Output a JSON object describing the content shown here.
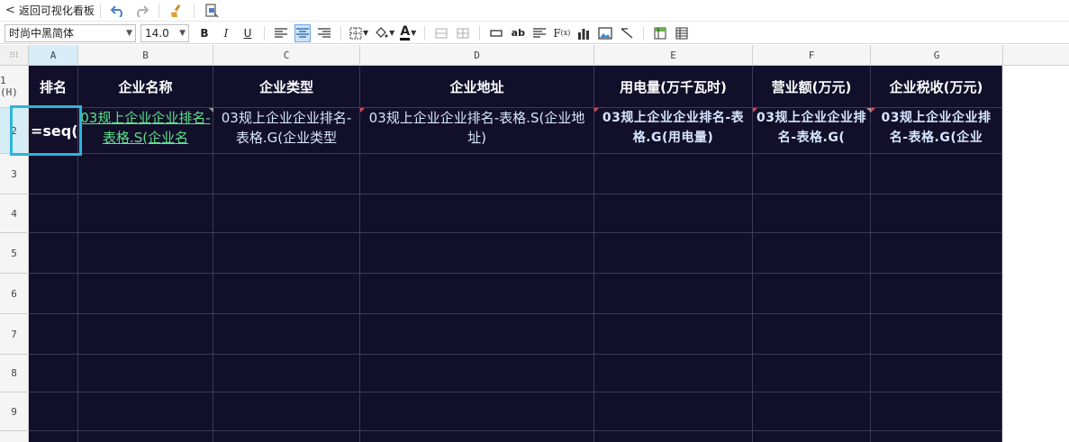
{
  "toolbar": {
    "back_label": "返回可视化看板",
    "font_family": "时尚中黑简体",
    "font_size": "14.0"
  },
  "columns": [
    "A",
    "B",
    "C",
    "D",
    "E",
    "F",
    "G"
  ],
  "rows": [
    "1 (H)",
    "2",
    "3",
    "4",
    "5",
    "6",
    "7",
    "8",
    "9"
  ],
  "header_row": [
    "排名",
    "企业名称",
    "企业类型",
    "企业地址",
    "用电量(万千瓦时)",
    "营业额(万元)",
    "企业税收(万元)"
  ],
  "data_row": {
    "a": "=seq()",
    "b": "03规上企业企业排名-表格.S(企业名",
    "c": "03规上企业企业排名-表格.G(企业类型",
    "d": "03规上企业企业排名-表格.S(企业地址)",
    "e": "03规上企业企业排名-表格.G(用电量)",
    "f": "03规上企业企业排名-表格.G(",
    "g": "03规上企业企业排名-表格.G(企业"
  },
  "colors": {
    "sheet_bg": "#120f2a",
    "selection": "#29b6d8",
    "link_text": "#5fe08a"
  }
}
